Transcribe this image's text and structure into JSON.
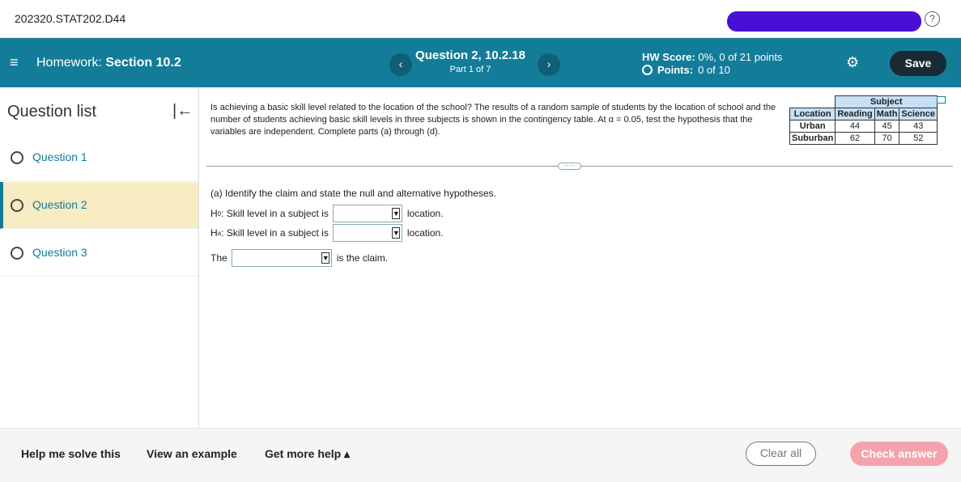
{
  "topbar": {
    "course": "202320.STAT202.D44",
    "help_icon": "?"
  },
  "hwbar": {
    "menu_icon": "≡",
    "homework_prefix": "Homework:",
    "homework_section": "Section 10.2",
    "prev_icon": "‹",
    "next_icon": "›",
    "question_title": "Question 2, 10.2.18",
    "question_part": "Part 1 of 7",
    "hw_score_label": "HW Score:",
    "hw_score_value": "0%, 0 of 21 points",
    "points_label": "Points:",
    "points_value": "0 of 10",
    "gear_icon": "⚙",
    "save_label": "Save"
  },
  "sidebar": {
    "title": "Question list",
    "collapse_icon": "|←",
    "items": [
      {
        "label": "Question 1"
      },
      {
        "label": "Question 2"
      },
      {
        "label": "Question 3"
      }
    ]
  },
  "question": {
    "text": "Is achieving a basic skill level related to the location of the school? The results of a random sample of students by the location of school and the number of students achieving basic skill levels in three subjects is shown in the contingency table. At α = 0.05, test the hypothesis that the variables are independent. Complete parts (a) through (d).",
    "table": {
      "subject_header": "Subject",
      "location_header": "Location",
      "columns": [
        "Reading",
        "Math",
        "Science"
      ],
      "rows": [
        {
          "label": "Urban",
          "values": [
            "44",
            "45",
            "43"
          ]
        },
        {
          "label": "Suburban",
          "values": [
            "62",
            "70",
            "52"
          ]
        }
      ]
    },
    "expand_dots": "·····",
    "part_a": "(a) Identify the claim and state the null and alternative hypotheses.",
    "h0_symbol": "H",
    "h0_sub": "0",
    "ha_symbol": "H",
    "ha_sub": "a",
    "hyp_text": ": Skill level in a subject is",
    "location_text": "location.",
    "the_text": "The",
    "claim_text": "is the claim.",
    "dropdown_arrow": "▼"
  },
  "footer": {
    "help_solve": "Help me solve this",
    "view_example": "View an example",
    "more_help": "Get more help ▴",
    "clear_all": "Clear all",
    "check_answer": "Check answer"
  },
  "colors": {
    "header_teal": "#137c99",
    "active_question": "#f7ebc1",
    "check_answer": "#f4a3ad"
  }
}
